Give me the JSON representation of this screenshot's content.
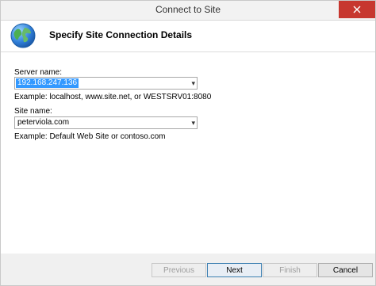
{
  "window": {
    "title": "Connect to Site"
  },
  "header": {
    "title": "Specify Site Connection Details"
  },
  "form": {
    "server_label": "Server name:",
    "server_value": "192.168.247.136",
    "server_example": "Example: localhost, www.site.net, or WESTSRV01:8080",
    "site_label": "Site name:",
    "site_value": "peterviola.com",
    "site_example": "Example: Default Web Site or contoso.com"
  },
  "buttons": {
    "previous": "Previous",
    "next": "Next",
    "finish": "Finish",
    "cancel": "Cancel"
  },
  "icons": {
    "close": "close-icon",
    "globe": "globe-icon",
    "dropdown": "chevron-down-icon"
  },
  "colors": {
    "selection": "#3399ff",
    "close_button": "#c7372f"
  }
}
